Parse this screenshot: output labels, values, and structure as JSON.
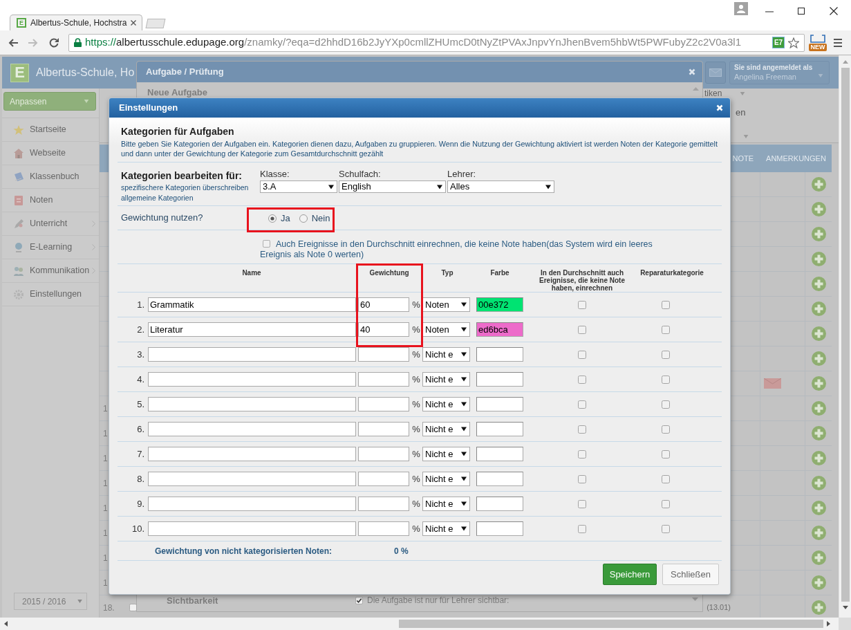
{
  "browser": {
    "tab": {
      "favicon": "E",
      "title": "Albertus-Schule, Hochstra"
    },
    "address": {
      "scheme": "https://",
      "host": "albertusschule.edupage.org",
      "path": "/znamky/?eqa=d2hhdD16b2JyYXp0cmllZHUmcD0tNyZtPVAxJnpvYnJhenBvem5hbWt5PWFubyZ2c2V0a3l1"
    },
    "page_action": "E7",
    "extension_badge": "NEW"
  },
  "app_header": {
    "logo": "E",
    "school_name": "Albertus-Schule, Ho",
    "login_caption": "Sie sind angemeldet als",
    "user_name": "Angelina Freeman"
  },
  "sidebar": {
    "customize_button": "Anpassen",
    "items": [
      {
        "label": "Startseite",
        "submenu": false
      },
      {
        "label": "Webseite",
        "submenu": false
      },
      {
        "label": "Klassenbuch",
        "submenu": false
      },
      {
        "label": "Noten",
        "submenu": false
      },
      {
        "label": "Unterricht",
        "submenu": true
      },
      {
        "label": "E-Learning",
        "submenu": true
      },
      {
        "label": "Kommunikation",
        "submenu": true
      },
      {
        "label": "Einstellungen",
        "submenu": false
      }
    ],
    "year_select": "2015 / 2016"
  },
  "filter_panel": {
    "fragments": [
      "tiken",
      "en"
    ]
  },
  "grade_table": {
    "columns": [
      "NOTE",
      "ANMERKUNGEN"
    ],
    "rows": [
      {
        "remark": false
      },
      {
        "remark": false
      },
      {
        "remark": false
      },
      {
        "remark": false
      },
      {
        "remark": false
      },
      {
        "remark": false
      },
      {
        "remark": false
      },
      {
        "remark": false
      },
      {
        "remark": true
      },
      {
        "number": "1",
        "remark": false
      },
      {
        "number": "1",
        "remark": false
      },
      {
        "number": "1",
        "remark": false
      },
      {
        "number": "1",
        "remark": false
      },
      {
        "number": "1",
        "remark": false
      },
      {
        "number": "1",
        "remark": false
      },
      {
        "number": "1",
        "remark": false
      },
      {
        "number": "1",
        "remark": false
      },
      {
        "number": "18.",
        "checked": false,
        "date": "(13.01)",
        "remark": false
      }
    ]
  },
  "task_dialog": {
    "title": "Aufgabe / Prüfung",
    "section": "Neue Aufgabe",
    "visibility_label": "Sichtbarkeit",
    "visibility_option": {
      "label": "Die Aufgabe ist nur für Lehrer sichtbar:",
      "checked": true
    }
  },
  "settings_dialog": {
    "title": "Einstellungen",
    "heading": "Kategorien für Aufgaben",
    "description": "Bitte geben Sie Kategorien der Aufgaben ein. Kategorien dienen dazu, Aufgaben zu gruppieren. Wenn die Nutzung der Gewichtung aktiviert ist werden Noten der Kategorie gemittelt und dann unter der Gewichtung der Kategorie zum Gesamtdurchschnitt gezählt",
    "scope": {
      "title": "Kategorien bearbeiten für:",
      "note": "spezifischere Kategorien überschreiben allgemeine Kategorien",
      "selects": [
        {
          "label": "Klasse:",
          "value": "3.A"
        },
        {
          "label": "Schulfach:",
          "value": "English"
        },
        {
          "label": "Lehrer:",
          "value": "Alles"
        }
      ]
    },
    "weighting": {
      "label": "Gewichtung nutzen?",
      "highlighted": true,
      "options": [
        {
          "label": "Ja",
          "selected": true
        },
        {
          "label": "Nein",
          "selected": false
        }
      ]
    },
    "include_empty": {
      "label": "Auch Ereignisse in den Durchschnitt einrechnen, die keine Note haben(das System wird ein leeres Ereignis als Note 0 werten)",
      "checked": false
    },
    "weight_column_highlighted": true,
    "columns": [
      "Name",
      "Gewichtung",
      "Typ",
      "Farbe",
      "In den Durchschnitt auch Ereignisse, die keine Note haben, einrechnen",
      "Reparaturkategorie"
    ],
    "rows": [
      {
        "number": "1.",
        "name": "Grammatik",
        "weight": "60",
        "unit": "%",
        "type": "Noten",
        "color": "#00e372",
        "color_code": "00e372",
        "average_checked": false,
        "repair_checked": false
      },
      {
        "number": "2.",
        "name": "Literatur",
        "weight": "40",
        "unit": "%",
        "type": "Noten",
        "color": "#ed6bca",
        "color_code": "ed6bca",
        "average_checked": false,
        "repair_checked": false
      },
      {
        "number": "3.",
        "unit": "%",
        "type": "Nicht e",
        "average_checked": false,
        "repair_checked": false
      },
      {
        "number": "4.",
        "unit": "%",
        "type": "Nicht e",
        "average_checked": false,
        "repair_checked": false
      },
      {
        "number": "5.",
        "unit": "%",
        "type": "Nicht e",
        "average_checked": false,
        "repair_checked": false
      },
      {
        "number": "6.",
        "unit": "%",
        "type": "Nicht e",
        "average_checked": false,
        "repair_checked": false
      },
      {
        "number": "7.",
        "unit": "%",
        "type": "Nicht e",
        "average_checked": false,
        "repair_checked": false
      },
      {
        "number": "8.",
        "unit": "%",
        "type": "Nicht e",
        "average_checked": false,
        "repair_checked": false
      },
      {
        "number": "9.",
        "unit": "%",
        "type": "Nicht e",
        "average_checked": false,
        "repair_checked": false
      },
      {
        "number": "10.",
        "unit": "%",
        "type": "Nicht e",
        "average_checked": false,
        "repair_checked": false
      }
    ],
    "uncategorized": {
      "label": "Gewichtung von nicht kategorisierten Noten:",
      "value": "0 %"
    },
    "buttons": [
      {
        "label": "Speichern",
        "kind": "primary"
      },
      {
        "label": "Schließen",
        "kind": "secondary"
      }
    ]
  }
}
